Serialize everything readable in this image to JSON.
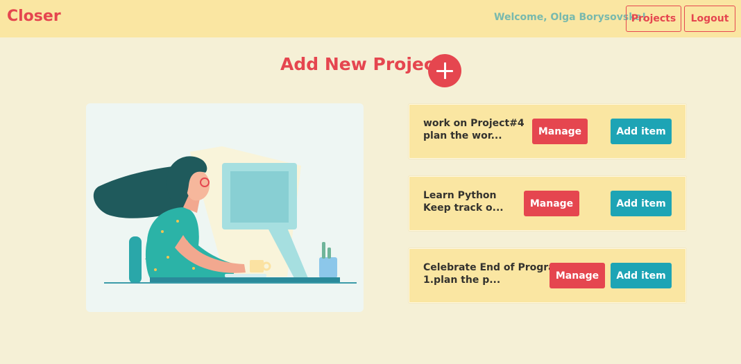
{
  "navbar": {
    "brand": "Closer",
    "welcome": "Welcome, Olga Borysovska!",
    "projects_label": "Projects",
    "logout_label": "Logout"
  },
  "main": {
    "add_title": "Add New Project",
    "add_icon": "plus-icon",
    "illustration": "woman-at-computer-illustration"
  },
  "projects": [
    {
      "line1": "work on Project#4",
      "line2": "plan the wor...",
      "manage_label": "Manage",
      "add_item_label": "Add item"
    },
    {
      "line1": "Learn Python",
      "line2": "Keep track o...",
      "manage_label": "Manage",
      "add_item_label": "Add item"
    },
    {
      "line1": "Celebrate End of Program",
      "line2": "1.plan the p...",
      "manage_label": "Manage",
      "add_item_label": "Add item"
    }
  ],
  "colors": {
    "background": "#f5f0d6",
    "navbar": "#fae6a2",
    "accent_red": "#e5464f",
    "accent_teal": "#1da4b5",
    "welcome_text": "#78b9ad"
  }
}
